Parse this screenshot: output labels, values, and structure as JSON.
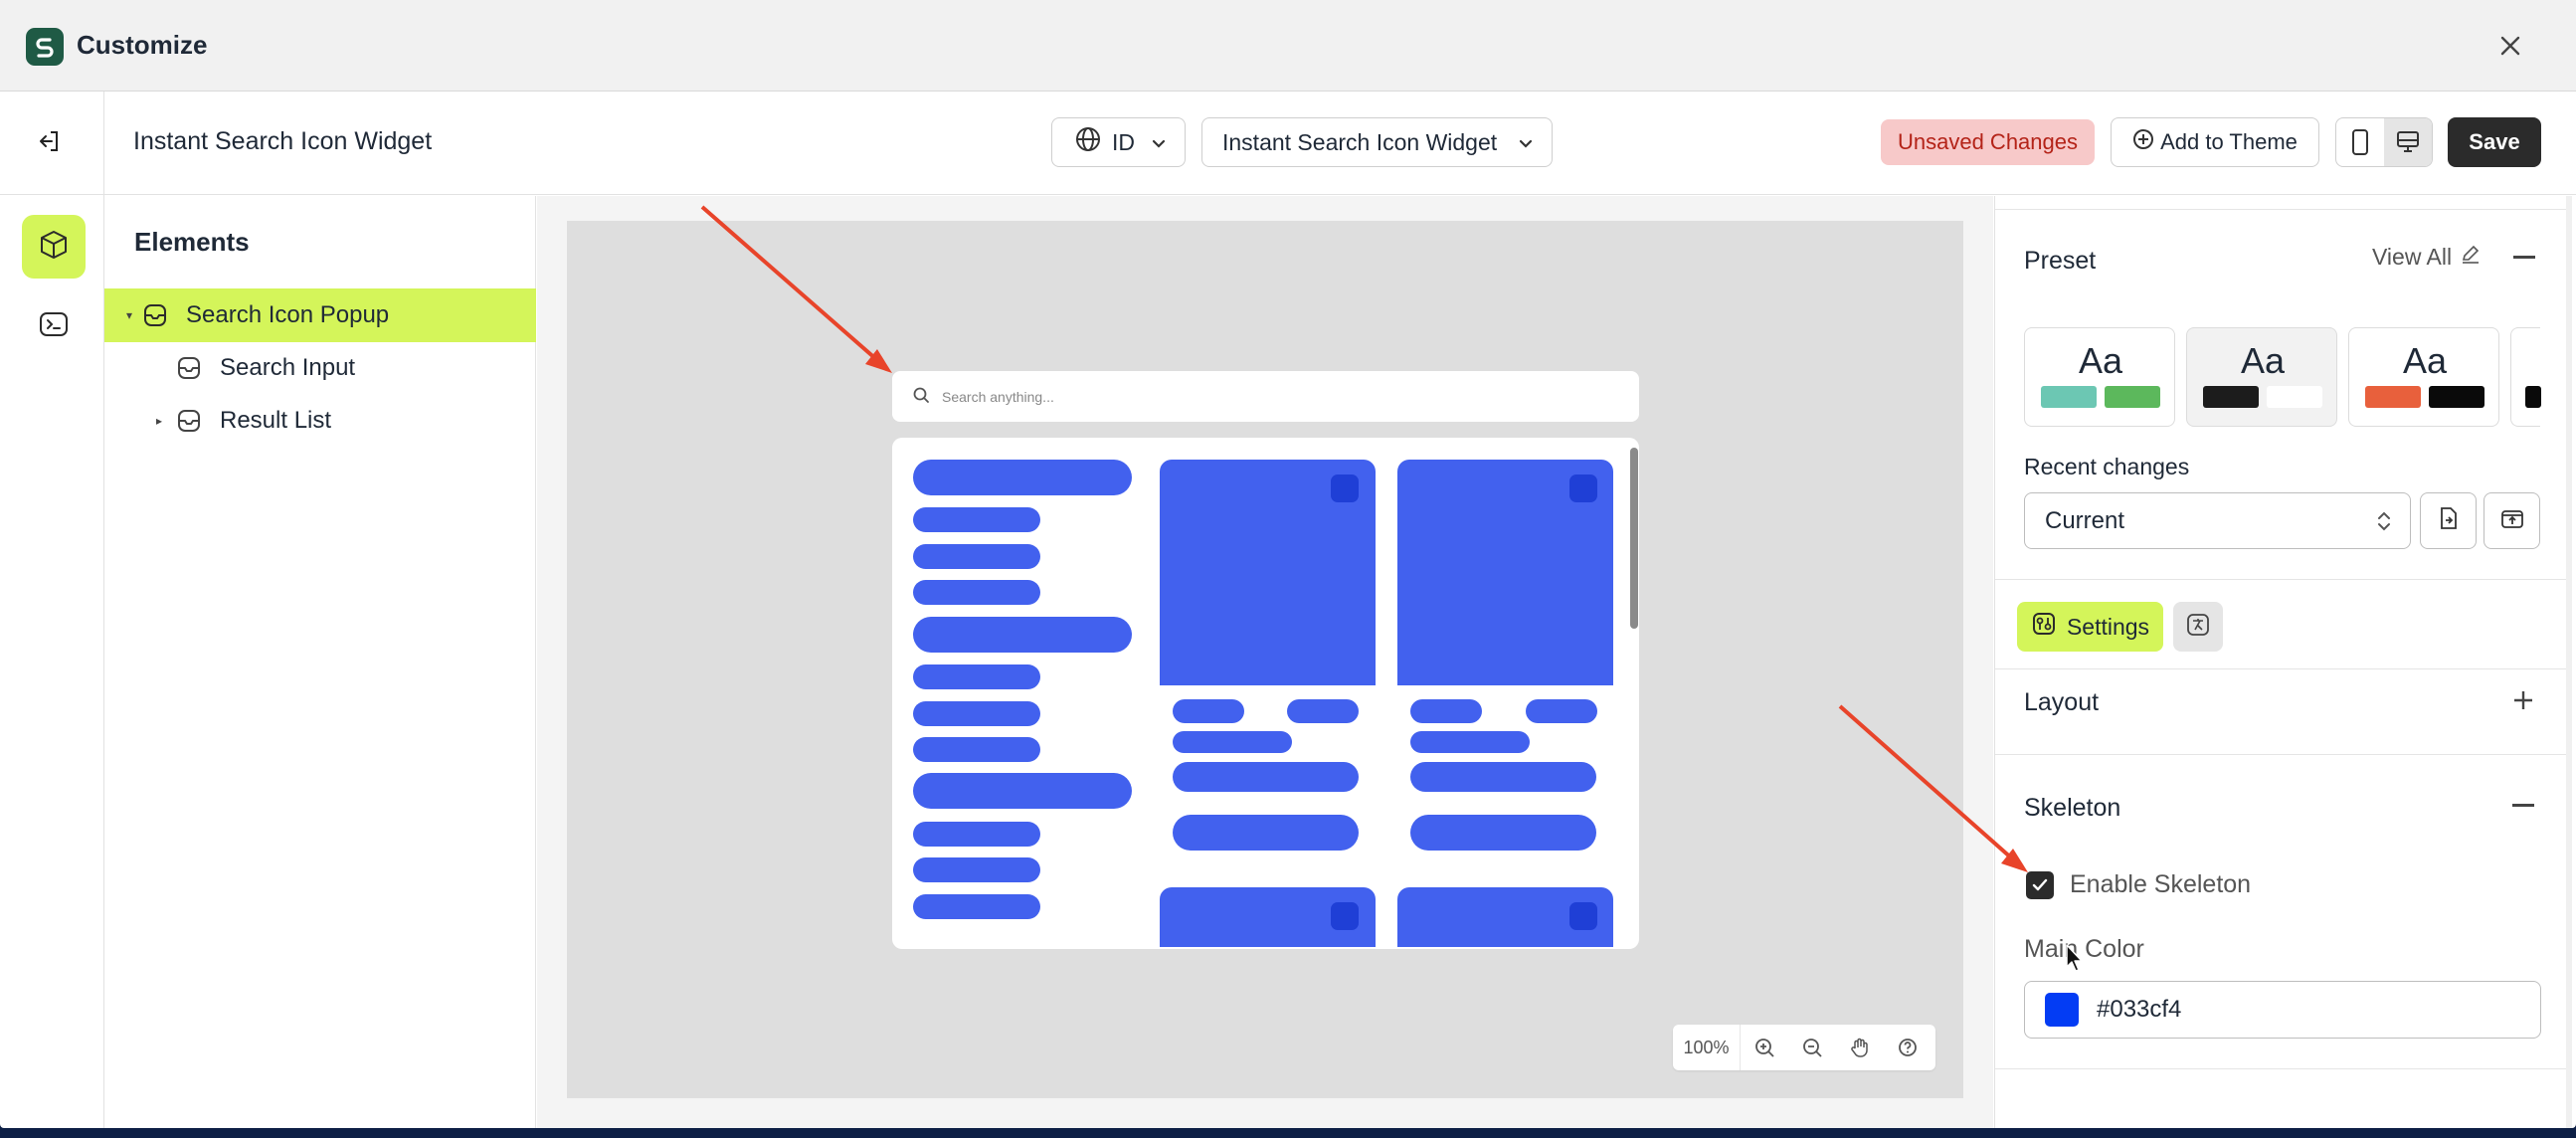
{
  "window": {
    "title": "Customize"
  },
  "header": {
    "page_title": "Instant Search Icon Widget",
    "language": "ID",
    "widget_select": "Instant Search Icon Widget",
    "unsaved": "Unsaved Changes",
    "add_to_theme": "Add to Theme",
    "save": "Save"
  },
  "elements": {
    "title": "Elements",
    "items": [
      {
        "label": "Search Icon Popup",
        "selected": true,
        "expanded": true
      },
      {
        "label": "Search Input"
      },
      {
        "label": "Result List",
        "collapsed": true
      }
    ]
  },
  "canvas": {
    "search_placeholder": "Search anything...",
    "zoom": "100%"
  },
  "panel": {
    "preset_title": "Preset",
    "view_all": "View All",
    "presets": [
      {
        "label": "Aa",
        "colors": [
          "#6cc7b3",
          "#5cb85c"
        ]
      },
      {
        "label": "Aa",
        "colors": [
          "#1c1c1c",
          "#ffffff"
        ]
      },
      {
        "label": "Aa",
        "colors": [
          "#e8603c",
          "#0a0a0a"
        ]
      }
    ],
    "recent_changes_label": "Recent changes",
    "recent_changes_value": "Current",
    "settings_tab": "Settings",
    "layout_title": "Layout",
    "skeleton_title": "Skeleton",
    "enable_skeleton": "Enable Skeleton",
    "enable_skeleton_checked": true,
    "main_color_label": "Main Color",
    "main_color_value": "#033cf4"
  },
  "colors": {
    "accent": "#d4f55a",
    "skeleton": "#4261ee",
    "annotation_arrow": "#e8442a"
  }
}
